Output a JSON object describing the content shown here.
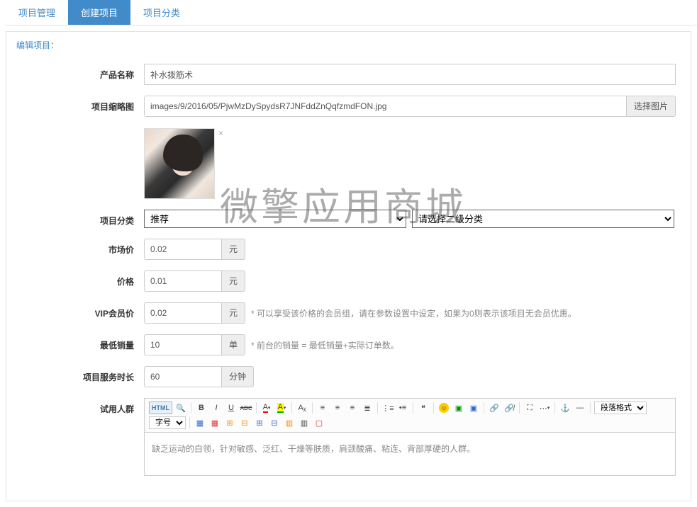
{
  "tabs": {
    "items": [
      {
        "label": "项目管理",
        "active": false
      },
      {
        "label": "创建项目",
        "active": true
      },
      {
        "label": "项目分类",
        "active": false
      }
    ]
  },
  "panel": {
    "title": "编辑项目："
  },
  "labels": {
    "product_name": "产品名称",
    "thumbnail": "项目缩略图",
    "category": "项目分类",
    "market_price": "市场价",
    "price": "价格",
    "vip_price": "VIP会员价",
    "min_sales": "最低销量",
    "duration": "项目服务时长",
    "audience": "试用人群"
  },
  "values": {
    "product_name": "补水拨筋术",
    "thumbnail_path": "images/9/2016/05/PjwMzDySpydsR7JNFddZnQqfzmdFON.jpg",
    "choose_image_btn": "选择图片",
    "category1_selected": "推荐",
    "category2_placeholder": "请选择二级分类",
    "market_price": "0.02",
    "price": "0.01",
    "vip_price": "0.02",
    "min_sales": "10",
    "duration": "60"
  },
  "units": {
    "yuan": "元",
    "dan": "单",
    "minute": "分钟"
  },
  "hints": {
    "vip": "* 可以享受该价格的会员组，请在参数设置中设定，如果为0则表示该项目无会员优惠。",
    "min_sales": "* 前台的销量 = 最低销量+实际订单数。"
  },
  "editor": {
    "dropdown_format": "段落格式",
    "dropdown_font": "字号",
    "content": "缺乏运动的白领，针对敏感、泛红、干燥等肤质，肩颈酸痛、粘连、背部厚硬的人群。"
  },
  "watermark": "微擎应用商城"
}
